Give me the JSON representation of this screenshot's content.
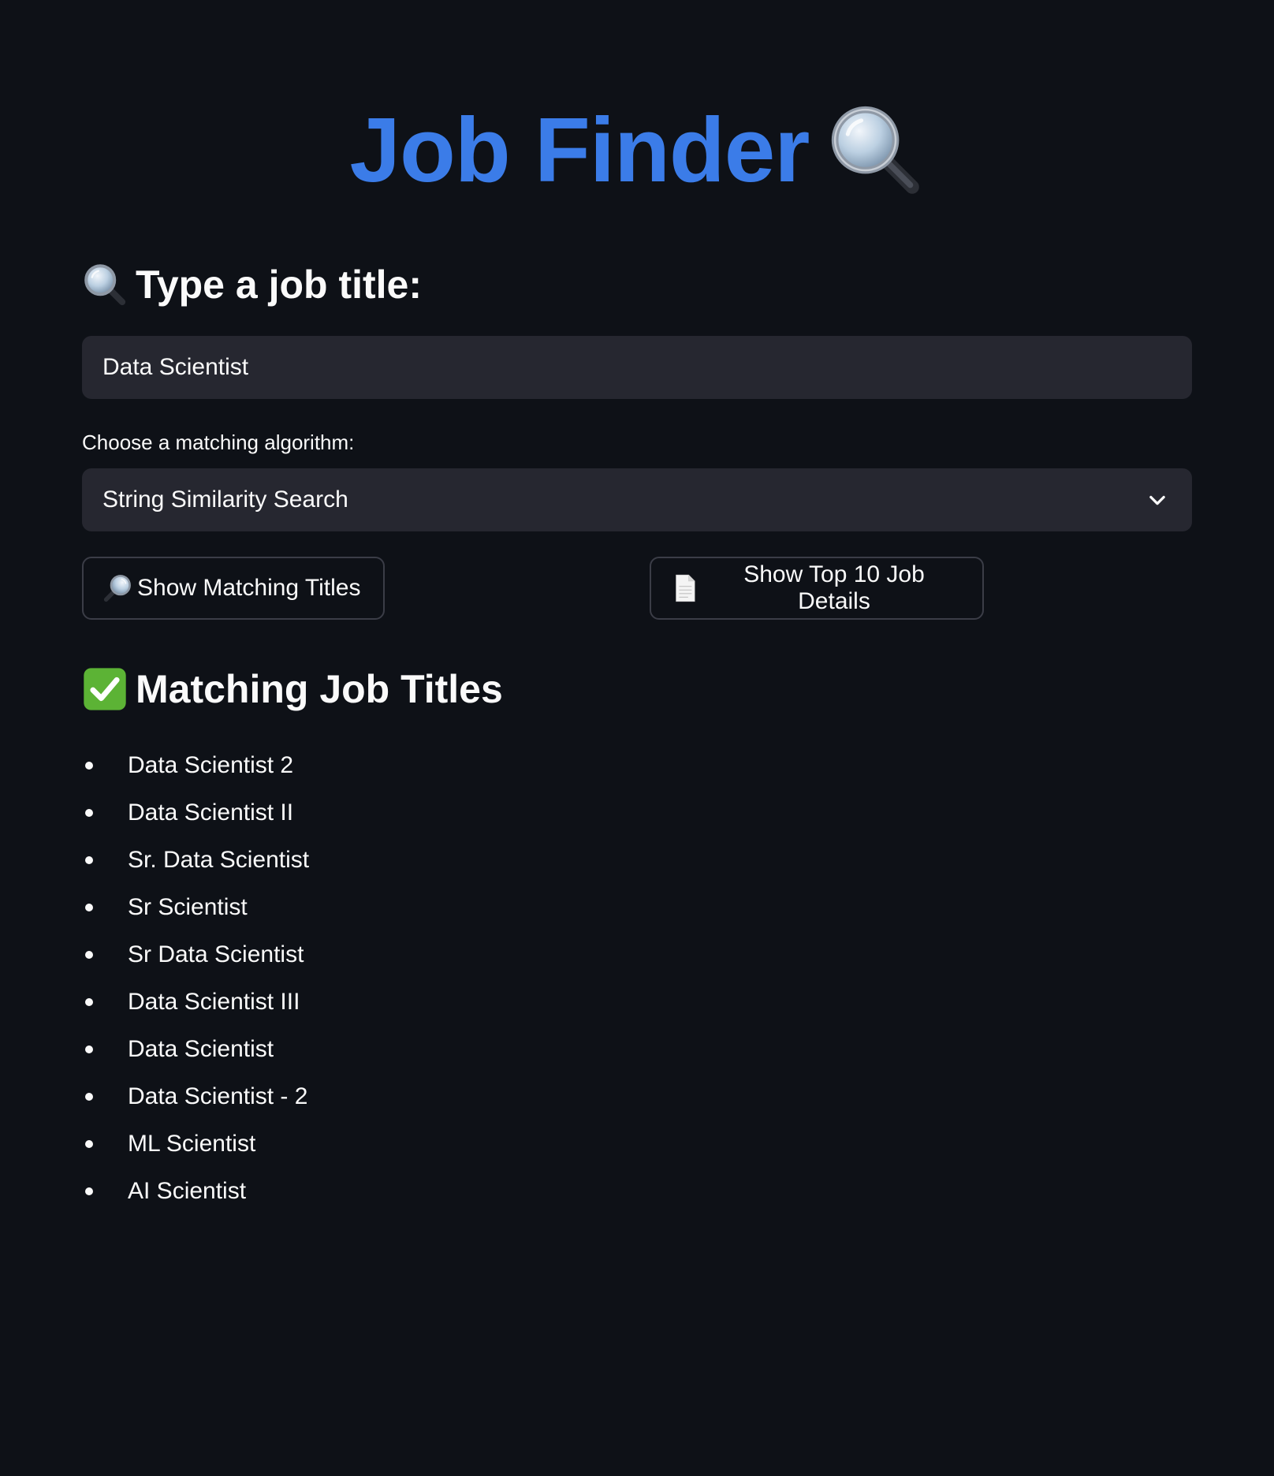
{
  "app": {
    "title": "Job Finder",
    "title_icon": "magnifying-glass-icon",
    "title_color": "#3b7ce8",
    "background": "#0e1117"
  },
  "search": {
    "heading": "Type a job title:",
    "heading_icon": "magnifying-glass-icon",
    "value": "Data Scientist",
    "placeholder": ""
  },
  "algorithm": {
    "label": "Choose a matching algorithm:",
    "selected": "String Similarity Search",
    "dropdown_icon": "chevron-down-icon"
  },
  "buttons": {
    "matching_titles": {
      "label": "Show Matching Titles",
      "icon": "magnifying-glass-right-icon"
    },
    "job_details": {
      "label": "Show Top 10 Job Details",
      "icon": "document-icon"
    }
  },
  "results": {
    "heading": "Matching Job Titles",
    "heading_icon": "check-mark-icon",
    "items": [
      "Data Scientist 2",
      "Data Scientist II",
      "Sr. Data Scientist",
      "Sr Scientist",
      "Sr Data Scientist",
      "Data Scientist III",
      "Data Scientist",
      "Data Scientist - 2",
      "ML Scientist",
      "AI Scientist"
    ]
  }
}
